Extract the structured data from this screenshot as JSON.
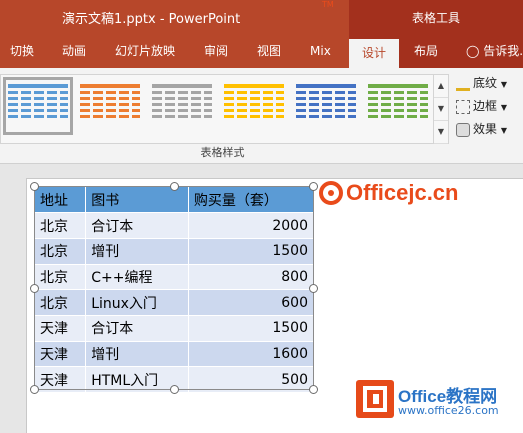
{
  "window": {
    "title": "演示文稿1.pptx - PowerPoint",
    "contextual_label": "表格工具"
  },
  "ribbon_tabs": [
    {
      "label": "切换"
    },
    {
      "label": "动画"
    },
    {
      "label": "幻灯片放映"
    },
    {
      "label": "审阅"
    },
    {
      "label": "视图"
    },
    {
      "label": "Mix"
    },
    {
      "label": "设计",
      "active": true
    },
    {
      "label": "布局"
    },
    {
      "label": "告诉我..."
    }
  ],
  "table_styles": {
    "group_label": "表格样式",
    "swatch_colors": [
      "#5b9bd5",
      "#ed7d31",
      "#a5a5a5",
      "#ffc000",
      "#4472c4",
      "#70ad47"
    ],
    "selected_index": 0
  },
  "side_commands": {
    "shading": "底纹",
    "border": "边框",
    "effects": "效果"
  },
  "table": {
    "headers": [
      "地址",
      "图书",
      "购买量（套）"
    ],
    "rows": [
      [
        "北京",
        "合订本",
        "2000"
      ],
      [
        "北京",
        "增刊",
        "1500"
      ],
      [
        "北京",
        "C++编程",
        "800"
      ],
      [
        "北京",
        "Linux入门",
        "600"
      ],
      [
        "天津",
        "合订本",
        "1500"
      ],
      [
        "天津",
        "增刊",
        "1600"
      ],
      [
        "天津",
        "HTML入门",
        "500"
      ]
    ]
  },
  "watermarks": {
    "site1": "Officejc.cn",
    "site1_tm": "TM",
    "site2_brand": "Office教程网",
    "site2_url": "www.office26.com"
  },
  "colors": {
    "accent": "#b7472a",
    "table_header": "#5b9bd5",
    "table_band_1": "#ccd8ee",
    "table_band_2": "#e8edf7"
  }
}
